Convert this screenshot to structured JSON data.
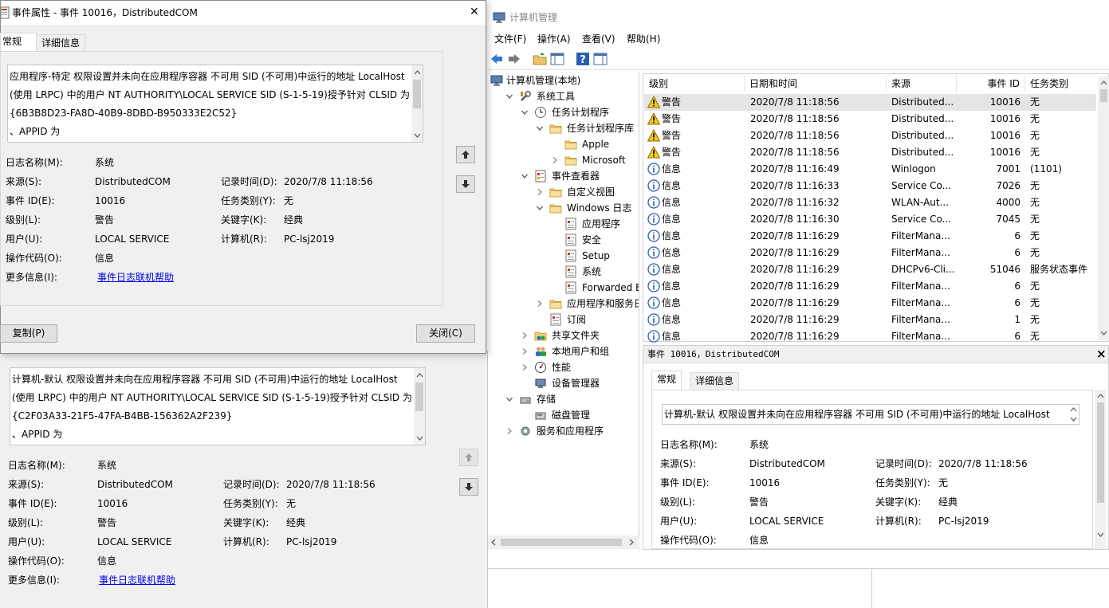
{
  "mmc": {
    "title": "计算机管理",
    "menu": [
      "文件(F)",
      "操作(A)",
      "查看(V)",
      "帮助(H)"
    ],
    "tree": [
      {
        "label": "计算机管理(本地)",
        "icon": "computer-management-icon",
        "level": 0,
        "chevron": "none"
      },
      {
        "label": "系统工具",
        "icon": "tools-icon",
        "level": 1,
        "chevron": "down"
      },
      {
        "label": "任务计划程序",
        "icon": "clock-icon",
        "level": 2,
        "chevron": "down"
      },
      {
        "label": "任务计划程序库",
        "icon": "folder-icon",
        "level": 3,
        "chevron": "down"
      },
      {
        "label": "Apple",
        "icon": "folder-icon",
        "level": 4,
        "chevron": "none"
      },
      {
        "label": "Microsoft",
        "icon": "folder-icon",
        "level": 4,
        "chevron": "right"
      },
      {
        "label": "事件查看器",
        "icon": "event-viewer-icon",
        "level": 2,
        "chevron": "down"
      },
      {
        "label": "自定义视图",
        "icon": "folder-icon",
        "level": 3,
        "chevron": "right"
      },
      {
        "label": "Windows 日志",
        "icon": "folder-icon",
        "level": 3,
        "chevron": "down"
      },
      {
        "label": "应用程序",
        "icon": "log-icon",
        "level": 4,
        "chevron": "none"
      },
      {
        "label": "安全",
        "icon": "log-icon",
        "level": 4,
        "chevron": "none"
      },
      {
        "label": "Setup",
        "icon": "log-icon",
        "level": 4,
        "chevron": "none"
      },
      {
        "label": "系统",
        "icon": "log-icon",
        "level": 4,
        "chevron": "none",
        "selected": true
      },
      {
        "label": "Forwarded Eve",
        "icon": "log-icon",
        "level": 4,
        "chevron": "none"
      },
      {
        "label": "应用程序和服务日志",
        "icon": "folder-icon",
        "level": 3,
        "chevron": "right"
      },
      {
        "label": "订阅",
        "icon": "log-icon",
        "level": 3,
        "chevron": "none"
      },
      {
        "label": "共享文件夹",
        "icon": "shared-folder-icon",
        "level": 2,
        "chevron": "right"
      },
      {
        "label": "本地用户和组",
        "icon": "users-icon",
        "level": 2,
        "chevron": "right"
      },
      {
        "label": "性能",
        "icon": "performance-icon",
        "level": 2,
        "chevron": "right"
      },
      {
        "label": "设备管理器",
        "icon": "device-manager-icon",
        "level": 2,
        "chevron": "none"
      },
      {
        "label": "存储",
        "icon": "storage-icon",
        "level": 1,
        "chevron": "down"
      },
      {
        "label": "磁盘管理",
        "icon": "disk-icon",
        "level": 2,
        "chevron": "none"
      },
      {
        "label": "服务和应用程序",
        "icon": "services-icon",
        "level": 1,
        "chevron": "right"
      }
    ],
    "columns": [
      "级别",
      "日期和时间",
      "来源",
      "事件 ID",
      "任务类别"
    ],
    "rows": [
      {
        "level": "警告",
        "type": "warning",
        "datetime": "2020/7/8 11:18:56",
        "source": "Distributed...",
        "id": "10016",
        "task": "无"
      },
      {
        "level": "警告",
        "type": "warning",
        "datetime": "2020/7/8 11:18:56",
        "source": "Distributed...",
        "id": "10016",
        "task": "无"
      },
      {
        "level": "警告",
        "type": "warning",
        "datetime": "2020/7/8 11:18:56",
        "source": "Distributed...",
        "id": "10016",
        "task": "无"
      },
      {
        "level": "警告",
        "type": "warning",
        "datetime": "2020/7/8 11:18:56",
        "source": "Distributed...",
        "id": "10016",
        "task": "无"
      },
      {
        "level": "信息",
        "type": "info",
        "datetime": "2020/7/8 11:16:49",
        "source": "Winlogon",
        "id": "7001",
        "task": "(1101)"
      },
      {
        "level": "信息",
        "type": "info",
        "datetime": "2020/7/8 11:16:33",
        "source": "Service Co...",
        "id": "7026",
        "task": "无"
      },
      {
        "level": "信息",
        "type": "info",
        "datetime": "2020/7/8 11:16:32",
        "source": "WLAN-Aut...",
        "id": "4000",
        "task": "无"
      },
      {
        "level": "信息",
        "type": "info",
        "datetime": "2020/7/8 11:16:30",
        "source": "Service Co...",
        "id": "7045",
        "task": "无"
      },
      {
        "level": "信息",
        "type": "info",
        "datetime": "2020/7/8 11:16:29",
        "source": "FilterMana...",
        "id": "6",
        "task": "无"
      },
      {
        "level": "信息",
        "type": "info",
        "datetime": "2020/7/8 11:16:29",
        "source": "FilterMana...",
        "id": "6",
        "task": "无"
      },
      {
        "level": "信息",
        "type": "info",
        "datetime": "2020/7/8 11:16:29",
        "source": "DHCPv6-Cli...",
        "id": "51046",
        "task": "服务状态事件"
      },
      {
        "level": "信息",
        "type": "info",
        "datetime": "2020/7/8 11:16:29",
        "source": "FilterMana...",
        "id": "6",
        "task": "无"
      },
      {
        "level": "信息",
        "type": "info",
        "datetime": "2020/7/8 11:16:29",
        "source": "FilterMana...",
        "id": "6",
        "task": "无"
      },
      {
        "level": "信息",
        "type": "info",
        "datetime": "2020/7/8 11:16:29",
        "source": "FilterMana...",
        "id": "1",
        "task": "无"
      },
      {
        "level": "信息",
        "type": "info",
        "datetime": "2020/7/8 11:16:29",
        "source": "FilterMana...",
        "id": "6",
        "task": "无"
      }
    ],
    "preview": {
      "title": "事件 10016，DistributedCOM",
      "close_glyph": "×",
      "tabs": [
        "常规",
        "详细信息"
      ],
      "description": "计算机-默认 权限设置并未向在应用程序容器 不可用 SID (不可用)中运行的地址 LocalHost",
      "fields": {
        "log_name_label": "日志名称(M):",
        "log_name": "系统",
        "source_label": "来源(S):",
        "source": "DistributedCOM",
        "recorded_label": "记录时间(D):",
        "recorded": "2020/7/8 11:18:56",
        "event_id_label": "事件 ID(E):",
        "event_id": "10016",
        "task_label": "任务类别(Y):",
        "task": "无",
        "level_label": "级别(L):",
        "level": "警告",
        "keywords_label": "关键字(K):",
        "keywords": "经典",
        "user_label": "用户(U):",
        "user": "LOCAL SERVICE",
        "computer_label": "计算机(R):",
        "computer": "PC-lsj2019",
        "opcode_label": "操作代码(O):",
        "opcode": "信息"
      }
    }
  },
  "dialog_back": {
    "description_lines": [
      "计算机-默认 权限设置并未向在应用程序容器 不可用 SID (不可用)中运行的地址 LocalHost",
      "(使用 LRPC) 中的用户 NT AUTHORITY\\LOCAL SERVICE SID (S-1-5-19)授予针对 CLSID 为",
      "{C2F03A33-21F5-47FA-B4BB-156362A2F239}",
      "、APPID 为"
    ],
    "log_name_label": "日志名称(M):",
    "log_name": "系统",
    "source_label": "来源(S):",
    "source": "DistributedCOM",
    "recorded_label": "记录时间(D):",
    "recorded": "2020/7/8 11:18:56",
    "event_id_label": "事件 ID(E):",
    "event_id": "10016",
    "task_label": "任务类别(Y):",
    "task": "无",
    "level_label": "级别(L):",
    "level": "警告",
    "keywords_label": "关键字(K):",
    "keywords": "经典",
    "user_label": "用户(U):",
    "user": "LOCAL SERVICE",
    "computer_label": "计算机(R):",
    "computer": "PC-lsj2019",
    "opcode_label": "操作代码(O):",
    "opcode": "信息",
    "more_info_label": "更多信息(I):",
    "more_info_link": "事件日志联机帮助"
  },
  "dialog_front": {
    "title": "事件属性 - 事件 10016，DistributedCOM",
    "close_glyph": "✕",
    "tabs": [
      "常规",
      "详细信息"
    ],
    "description_lines": [
      "应用程序-特定 权限设置并未向在应用程序容器 不可用 SID (不可用)中运行的地址 LocalHost",
      "(使用 LRPC) 中的用户 NT AUTHORITY\\LOCAL SERVICE SID (S-1-5-19)授予针对 CLSID 为",
      "{6B3B8D23-FA8D-40B9-8DBD-B950333E2C52}",
      "、APPID 为"
    ],
    "log_name_label": "日志名称(M):",
    "log_name": "系统",
    "source_label": "来源(S):",
    "source": "DistributedCOM",
    "recorded_label": "记录时间(D):",
    "recorded": "2020/7/8 11:18:56",
    "event_id_label": "事件 ID(E):",
    "event_id": "10016",
    "task_label": "任务类别(Y):",
    "task": "无",
    "level_label": "级别(L):",
    "level": "警告",
    "keywords_label": "关键字(K):",
    "keywords": "经典",
    "user_label": "用户(U):",
    "user": "LOCAL SERVICE",
    "computer_label": "计算机(R):",
    "computer": "PC-lsj2019",
    "opcode_label": "操作代码(O):",
    "opcode": "信息",
    "more_info_label": "更多信息(I):",
    "more_info_link": "事件日志联机帮助",
    "copy_button": "复制(P)",
    "close_button": "关闭(C)"
  }
}
